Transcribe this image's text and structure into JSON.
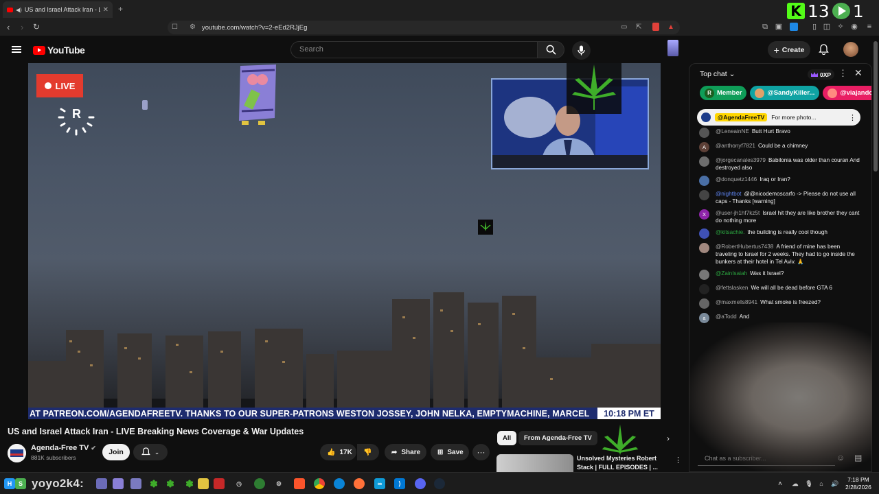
{
  "browser": {
    "tab_title": "US and Israel Attack Iran - LIV",
    "url": "youtube.com/watch?v=2-eEd2RJjEg",
    "new_tab_symbol": "+"
  },
  "overlay_counter": {
    "left_badge": "K",
    "value_a": "13",
    "value_b": "1"
  },
  "youtube": {
    "logo_text": "YouTube",
    "search_placeholder": "Search",
    "create_label": "Create"
  },
  "video": {
    "live_label": "LIVE",
    "ticker_text": "AT PATREON.COM/AGENDAFREETV. THANKS TO OUR SUPER-PATRONS WESTON JOSSEY, JOHN NELKA, EMPTYMACHINE, MARCEL",
    "ticker_time": "10:18 PM ET",
    "title": "US and Israel Attack Iran - LIVE Breaking News Coverage & War Updates"
  },
  "channel": {
    "name": "Agenda-Free TV",
    "subscribers": "881K subscribers",
    "join_label": "Join"
  },
  "actions": {
    "likes": "17K",
    "share": "Share",
    "save": "Save",
    "more": "···"
  },
  "recommendations": {
    "chips": [
      "All",
      "From Agenda-Free TV"
    ],
    "item_title": "Unsolved Mysteries Robert Stack | FULL EPISODES | ..."
  },
  "chat": {
    "mode": "Top chat",
    "xp": "0XP",
    "tickers": [
      {
        "label": "Member",
        "initial": "R",
        "color": "#0f9d58"
      },
      {
        "label": "@SandyKiller...",
        "initial": "",
        "color": "#0fa3a3"
      },
      {
        "label": "@viajandoan...",
        "initial": "",
        "color": "#e91e63"
      }
    ],
    "pinned": {
      "author": "@AgendaFreeTV",
      "text": "For more photo..."
    },
    "messages": [
      {
        "author": "@LeneainNE",
        "text": "Butt Hurt Bravo",
        "avatar": "",
        "avcolor": "#555",
        "style": ""
      },
      {
        "author": "@anthonyf7821",
        "text": "Could be a chimney",
        "avatar": "A",
        "avcolor": "#5d4037",
        "style": ""
      },
      {
        "author": "@jorgecanales3979",
        "text": "Babilonia was older than couran And destroyed also",
        "avatar": "",
        "avcolor": "#6d6d6d",
        "style": ""
      },
      {
        "author": "@donquetz1446",
        "text": "Iraq or Iran?",
        "avatar": "",
        "avcolor": "#4a6fa5",
        "style": ""
      },
      {
        "author": "@nightbot",
        "text": "@@nicodemoscarfo -> Please do not use all caps - Thanks [warning]",
        "avatar": "",
        "avcolor": "#444",
        "style": "blue"
      },
      {
        "author": "@user-jh1hf7kz5t",
        "text": "Israel hit they are like brother they cant do nothing more",
        "avatar": "X",
        "avcolor": "#8e24aa",
        "style": ""
      },
      {
        "author": "@kitsachie.",
        "text": "the building is really cool though",
        "avatar": "",
        "avcolor": "#3f51b5",
        "style": "green"
      },
      {
        "author": "@RobertHubertus7438",
        "text": "A friend of mine has been traveling to Israel for 2 weeks. They had to go inside the bunkers at their hotel in Tel Aviv. 🙏",
        "avatar": "",
        "avcolor": "#a1887f",
        "style": ""
      },
      {
        "author": "@ZainIsaiah",
        "text": "Was it Israel?",
        "avatar": "",
        "avcolor": "#777",
        "style": "green"
      },
      {
        "author": "@fettslasken",
        "text": "We will all be dead before GTA 6",
        "avatar": "",
        "avcolor": "#222",
        "style": ""
      },
      {
        "author": "@maxmells8941",
        "text": "What smoke is freezed?",
        "avatar": "",
        "avcolor": "#666",
        "style": ""
      },
      {
        "author": "@aTodd",
        "text": "And",
        "avatar": "a",
        "avcolor": "#7a8a9a",
        "style": ""
      }
    ],
    "input_placeholder": "Chat as a subscriber..."
  },
  "taskbar": {
    "label": "yoyo2k4:",
    "time": "7:18 PM",
    "date": "2/28/2026"
  }
}
